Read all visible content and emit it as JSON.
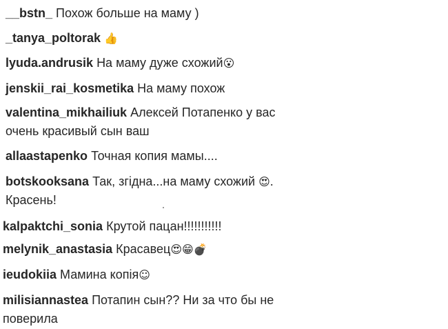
{
  "comments": [
    {
      "username": "__bstn_",
      "text": "Похож больше на маму )",
      "emoji": ""
    },
    {
      "username": "_tanya_poltorak",
      "text": "",
      "emoji": "👍"
    },
    {
      "username": "lyuda.andrusik",
      "text": "На маму дуже схожий",
      "emoji": "😮"
    },
    {
      "username": "jenskii_rai_kosmetika",
      "text": "На маму похож",
      "emoji": ""
    },
    {
      "username": "valentina_mikhailiuk",
      "text": "Алексей Потапенко у вас очень красивый сын ваш",
      "emoji": ""
    },
    {
      "username": "allaastapenko",
      "text": "Точная копия мамы....",
      "emoji": ""
    },
    {
      "username": "botskooksana",
      "text": "Так, згідна...на маму схожий",
      "emoji": "😍",
      "text_after": ". Красень!"
    },
    {
      "username": "kalpaktchi_sonia",
      "text": "Крутой пацан!!!!!!!!!!!",
      "emoji": ""
    },
    {
      "username": "melynik_anastasia",
      "text": "Красавец",
      "emoji": "😍😁💣"
    },
    {
      "username": "ieudokiia",
      "text": "Мамина копія",
      "emoji": "☺"
    },
    {
      "username": "milisiannastea",
      "text": "Потапин сын?? Ни за что бы не поверила",
      "emoji": ""
    }
  ]
}
